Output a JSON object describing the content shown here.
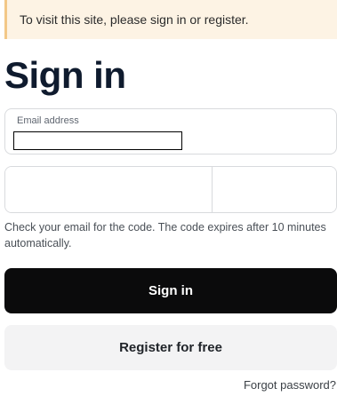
{
  "notice": {
    "text": "To visit this site, please sign in or register."
  },
  "title": "Sign in",
  "email": {
    "label": "Email address",
    "value": ""
  },
  "code": {
    "cells": [
      "",
      "",
      "",
      "",
      "",
      ""
    ]
  },
  "hint": "Check your email for the code. The code expires after 10 minutes automatically.",
  "buttons": {
    "sign_in": "Sign in",
    "register": "Register for free"
  },
  "forgot_password": "Forgot password?",
  "colors": {
    "notice_bg": "#fdf3e4",
    "notice_border": "#f3c888",
    "primary_button": "#0b0b0c",
    "secondary_button": "#f3f3f4",
    "title": "#0f1b2e"
  }
}
